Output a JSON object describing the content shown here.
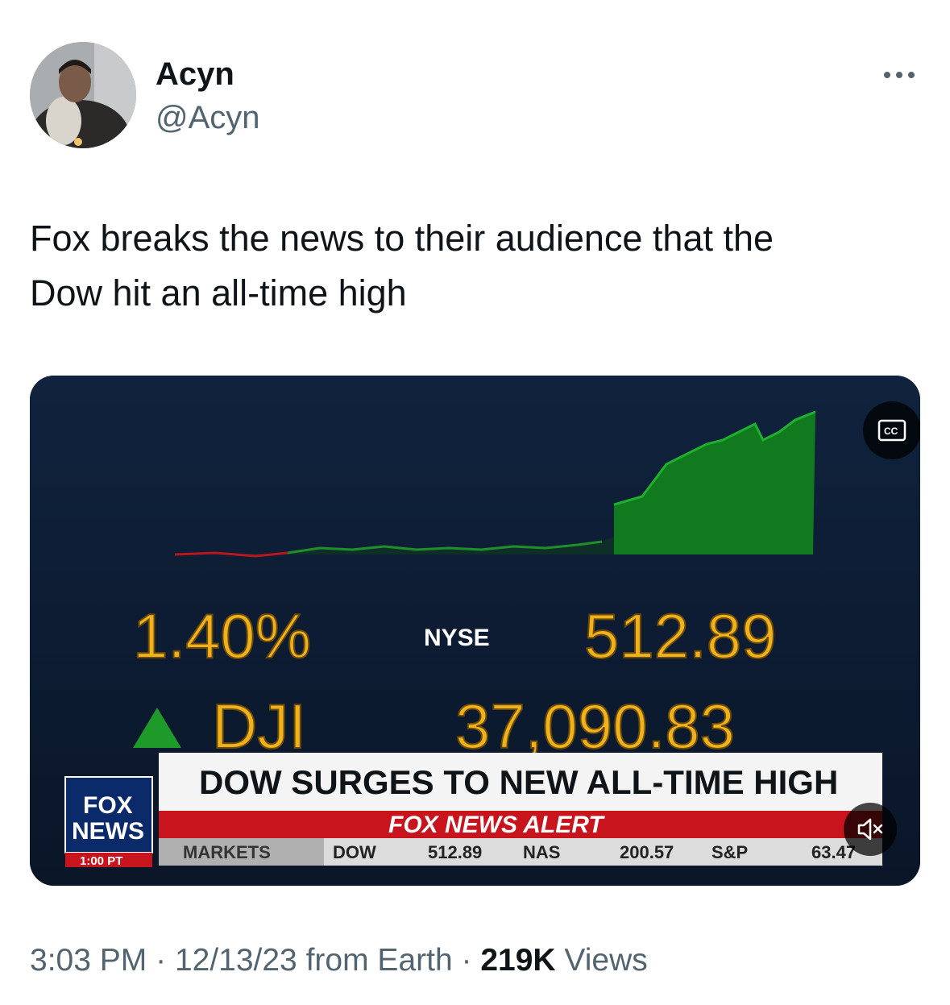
{
  "author": {
    "name": "Acyn",
    "handle": "@Acyn"
  },
  "tweet": {
    "text_line1": "Fox breaks the news to their audience that the",
    "text_line2": "Dow hit an all-time high"
  },
  "media": {
    "percent_change": "1.40%",
    "exchange_logo": "NYSE",
    "point_change": "512.89",
    "ticker": "DJI",
    "index_value": "37,090.83",
    "headline": "DOW SURGES TO NEW ALL-TIME HIGH",
    "alert_label": "FOX NEWS ALERT",
    "network_logo_line1": "FOX",
    "network_logo_line2": "NEWS",
    "time_tag": "1:00 PT",
    "ticker_bar": {
      "section": "MARKETS",
      "items": [
        {
          "symbol": "DOW",
          "value": "512.89"
        },
        {
          "symbol": "NAS",
          "value": "200.57"
        },
        {
          "symbol": "S&P",
          "value": "63.47"
        }
      ]
    },
    "cc_icon": "closed-captions-icon",
    "mute_icon": "speaker-muted-icon",
    "colors": {
      "background": "#0c1c33",
      "up_green": "#1d9a2a",
      "gold": "#f0b21c",
      "alert_red": "#c8141c"
    }
  },
  "meta": {
    "time": "3:03 PM",
    "sep1": "·",
    "date": "12/13/23",
    "source": "from Earth",
    "sep2": "·",
    "views_count": "219K",
    "views_label": "Views"
  }
}
